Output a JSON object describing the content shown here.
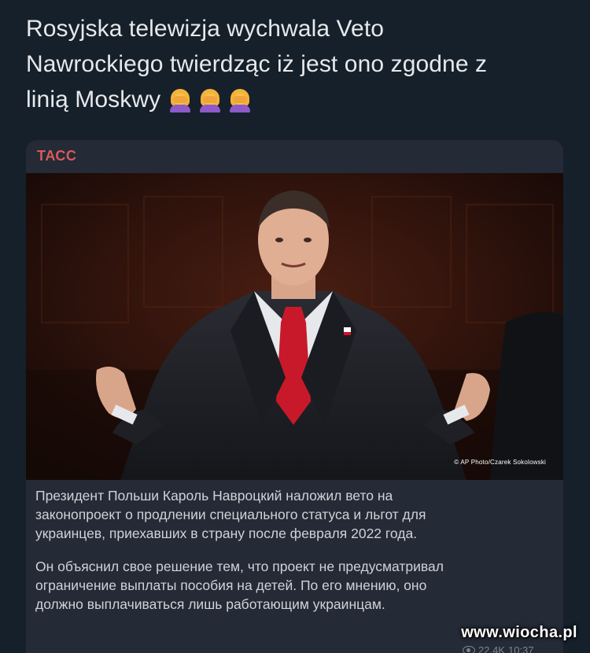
{
  "post": {
    "text": "Rosyjska telewizja wychwala Veto\nNawrockiego twierdząc iż jest ono zgodne z\nlinią Moskwy",
    "emojis": [
      "woman-facepalming-icon",
      "woman-facepalming-icon",
      "woman-facepalming-icon"
    ]
  },
  "embed": {
    "source": "ТАСС",
    "photo_credit": "© AP Photo/Czarek Sokolowski",
    "caption_paragraphs": [
      "Президент Польши Кароль Навроцкий наложил вето на\nзаконопроект о продлении специального статуса и льгот для\nукраинцев, приехавших в страну после февраля 2022 года.",
      "Он объяснил свое решение тем, что проект не предусматривал\nограничение выплаты пособия на детей. По его мнению, оно\nдолжно выплачиваться лишь работающим украинцам."
    ],
    "views": "22.4K",
    "time": "10:37"
  },
  "watermark": "www.wiocha.pl",
  "colors": {
    "background": "#15202b",
    "card": "#242a36",
    "source_red": "#d55b5b",
    "tie_red": "#c8192a"
  }
}
